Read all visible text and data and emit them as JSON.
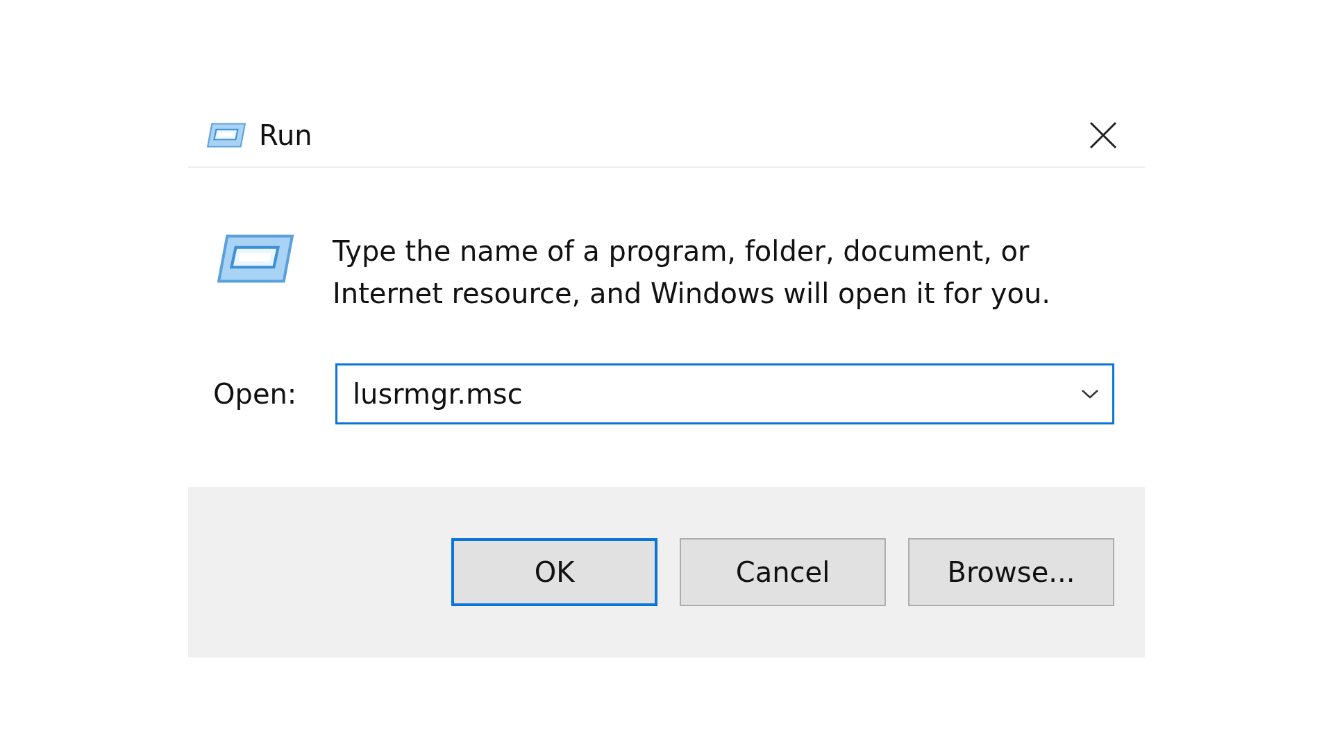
{
  "window": {
    "title": "Run"
  },
  "message": "Type the name of a program, folder, document, or Internet resource, and Windows will open it for you.",
  "open_field": {
    "label": "Open:",
    "value": "lusrmgr.msc",
    "focused": true
  },
  "buttons": [
    {
      "label": "OK",
      "default": true
    },
    {
      "label": "Cancel",
      "default": false
    },
    {
      "label": "Browse...",
      "default": false
    }
  ]
}
